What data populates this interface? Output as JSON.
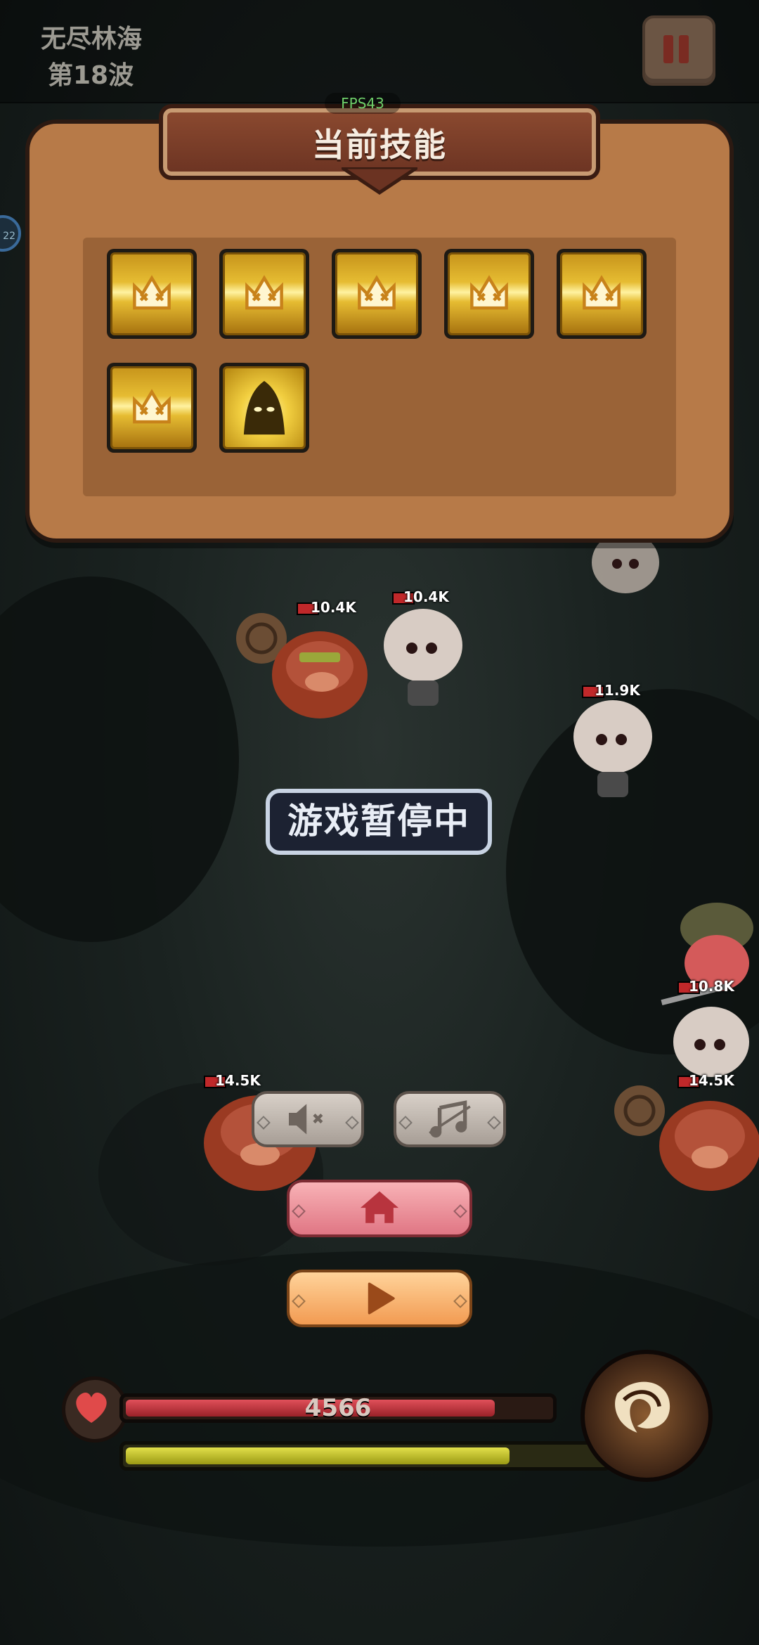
{
  "stage": {
    "name": "无尽林海",
    "wave": "第18波"
  },
  "fps": "FPS43",
  "panel": {
    "title": "当前技能",
    "skills": [
      {
        "name": "skill-slot",
        "icon": "crown-x-icon"
      },
      {
        "name": "skill-slot",
        "icon": "crown-x-icon"
      },
      {
        "name": "skill-slot",
        "icon": "crown-x-icon"
      },
      {
        "name": "skill-slot",
        "icon": "crown-x-icon"
      },
      {
        "name": "skill-slot",
        "icon": "crown-x-icon"
      },
      {
        "name": "skill-slot",
        "icon": "crown-x-icon"
      },
      {
        "name": "skill-slot",
        "icon": "hooded-figure-icon"
      }
    ]
  },
  "paused_label": "游戏暂停中",
  "enemies": [
    {
      "type": "boar",
      "hp": "10.4K"
    },
    {
      "type": "skeleton",
      "hp": "10.4K"
    },
    {
      "type": "skeleton",
      "hp": "11.9K"
    },
    {
      "type": "skeleton",
      "hp": "10.8K"
    },
    {
      "type": "boar",
      "hp": "14.5K"
    },
    {
      "type": "boar",
      "hp": "14.5K"
    }
  ],
  "side_badge": "22",
  "controls": {
    "mute": "mute-icon",
    "music": "music-off-icon",
    "home": "home-icon",
    "resume": "play-icon"
  },
  "player": {
    "hp": "4566",
    "hp_fraction": 0.87,
    "xp_fraction": 0.8
  },
  "colors": {
    "panel": "#b77a48",
    "banner": "#8c4a30",
    "gold": "#e6bc32",
    "home_button": "#f0939c",
    "play_button": "#f9b874"
  }
}
